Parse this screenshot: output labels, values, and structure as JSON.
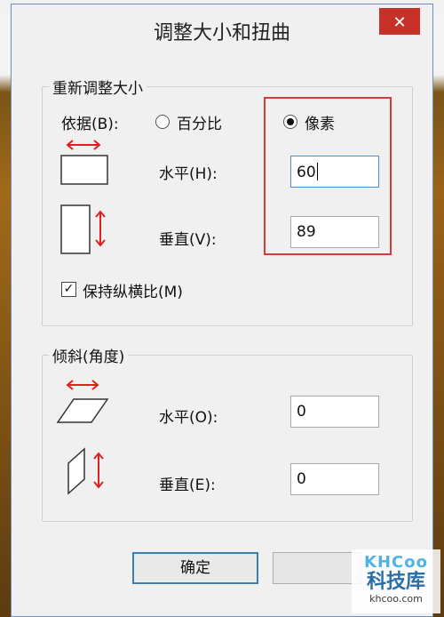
{
  "dialog": {
    "title": "调整大小和扭曲",
    "close_icon": "close-icon"
  },
  "resize": {
    "group_label": "重新调整大小",
    "basis_label": "依据(B):",
    "option_percent": "百分比",
    "option_pixels": "像素",
    "selected": "像素",
    "horizontal_label": "水平(H):",
    "horizontal_value": "60",
    "vertical_label": "垂直(V):",
    "vertical_value": "89",
    "keep_ratio_label": "保持纵横比(M)",
    "keep_ratio_checked": "✓"
  },
  "skew": {
    "group_label": "倾斜(角度)",
    "horizontal_label": "水平(O):",
    "horizontal_value": "0",
    "vertical_label": "垂直(E):",
    "vertical_value": "0"
  },
  "buttons": {
    "ok_label": "确定"
  },
  "watermark": {
    "logo": "KHCoo",
    "name": "科技库",
    "url": "khcoo.com"
  },
  "colors": {
    "accent_red": "#d63a3a",
    "arrow_red": "#e02020",
    "focus_blue": "#4a90d9",
    "close_red": "#c7312a"
  }
}
